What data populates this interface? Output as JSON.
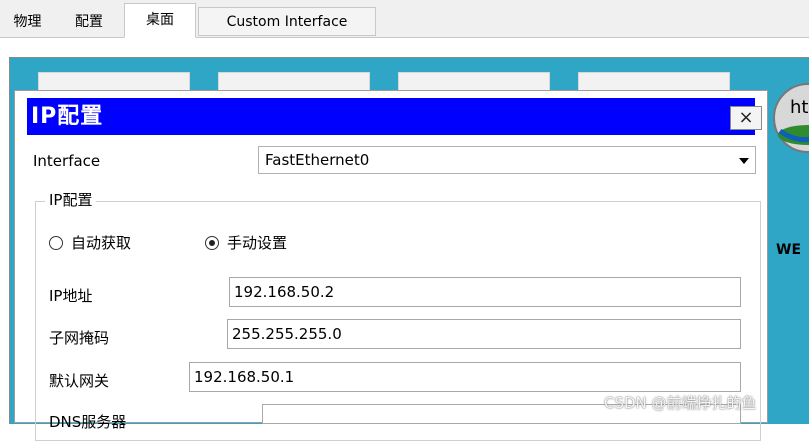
{
  "tabs": [
    {
      "label": "物理",
      "active": false
    },
    {
      "label": "配置",
      "active": false
    },
    {
      "label": "桌面",
      "active": true
    },
    {
      "label": "Custom Interface",
      "active": false
    }
  ],
  "desktop": {
    "background_color": "#30a6c6",
    "web_label": "WE",
    "globe_text": "ht"
  },
  "dialog": {
    "title": "IP配置",
    "close_glyph": "×",
    "interface_label": "Interface",
    "interface_value": "FastEthernet0",
    "group_title": "IP配置",
    "radio_dhcp": "自动获取",
    "radio_static": "手动设置",
    "ip_label": "IP地址",
    "ip_value": "192.168.50.2",
    "mask_label": "子网掩码",
    "mask_value": "255.255.255.0",
    "gateway_label": "默认网关",
    "gateway_value": "192.168.50.1",
    "dns_label": "DNS服务器",
    "dns_value": ""
  },
  "watermark": "CSDN @前端挣扎的鱼",
  "colors": {
    "title_bar": "#0000ff",
    "desktop": "#30a6c6"
  }
}
